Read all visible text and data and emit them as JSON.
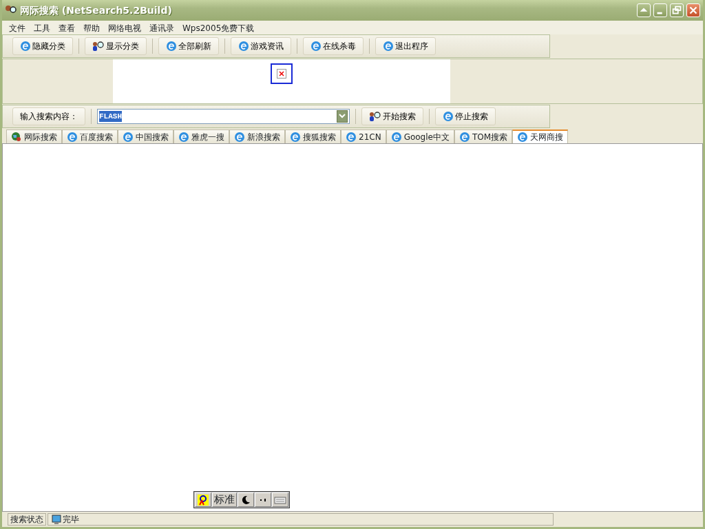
{
  "window": {
    "title": "网际搜索 (NetSearch5.2Build)"
  },
  "menu": [
    "文件",
    "工具",
    "查看",
    "帮助",
    "网络电视",
    "通讯录",
    "Wps2005免费下载"
  ],
  "toolbar": [
    {
      "label": "隐藏分类",
      "kind": "ie"
    },
    {
      "label": "显示分类",
      "kind": "person"
    },
    {
      "label": "全部刷新",
      "kind": "ie"
    },
    {
      "label": "游戏资讯",
      "kind": "ie"
    },
    {
      "label": "在线杀毒",
      "kind": "ie"
    },
    {
      "label": "退出程序",
      "kind": "ie"
    }
  ],
  "search": {
    "label": "输入搜索内容：",
    "value": "FLASH",
    "buttons": [
      {
        "label": "开始搜索",
        "kind": "person"
      },
      {
        "label": "停止搜索",
        "kind": "ie"
      }
    ]
  },
  "tabs": [
    {
      "label": "网际搜索",
      "kind": "globe",
      "selected": false
    },
    {
      "label": "百度搜索",
      "kind": "ie",
      "selected": false
    },
    {
      "label": "中国搜索",
      "kind": "ie",
      "selected": false
    },
    {
      "label": "雅虎一搜",
      "kind": "ie",
      "selected": false
    },
    {
      "label": "新浪搜索",
      "kind": "ie",
      "selected": false
    },
    {
      "label": "搜狐搜索",
      "kind": "ie",
      "selected": false
    },
    {
      "label": "21CN",
      "kind": "ie",
      "selected": false
    },
    {
      "label": "Google中文",
      "kind": "ie",
      "selected": false
    },
    {
      "label": "TOM搜索",
      "kind": "ie",
      "selected": false
    },
    {
      "label": "天网商搜",
      "kind": "ie",
      "selected": true
    }
  ],
  "ime_bar": {
    "mode": "标准"
  },
  "status_bar": {
    "label": "搜索状态",
    "message": "完毕"
  }
}
